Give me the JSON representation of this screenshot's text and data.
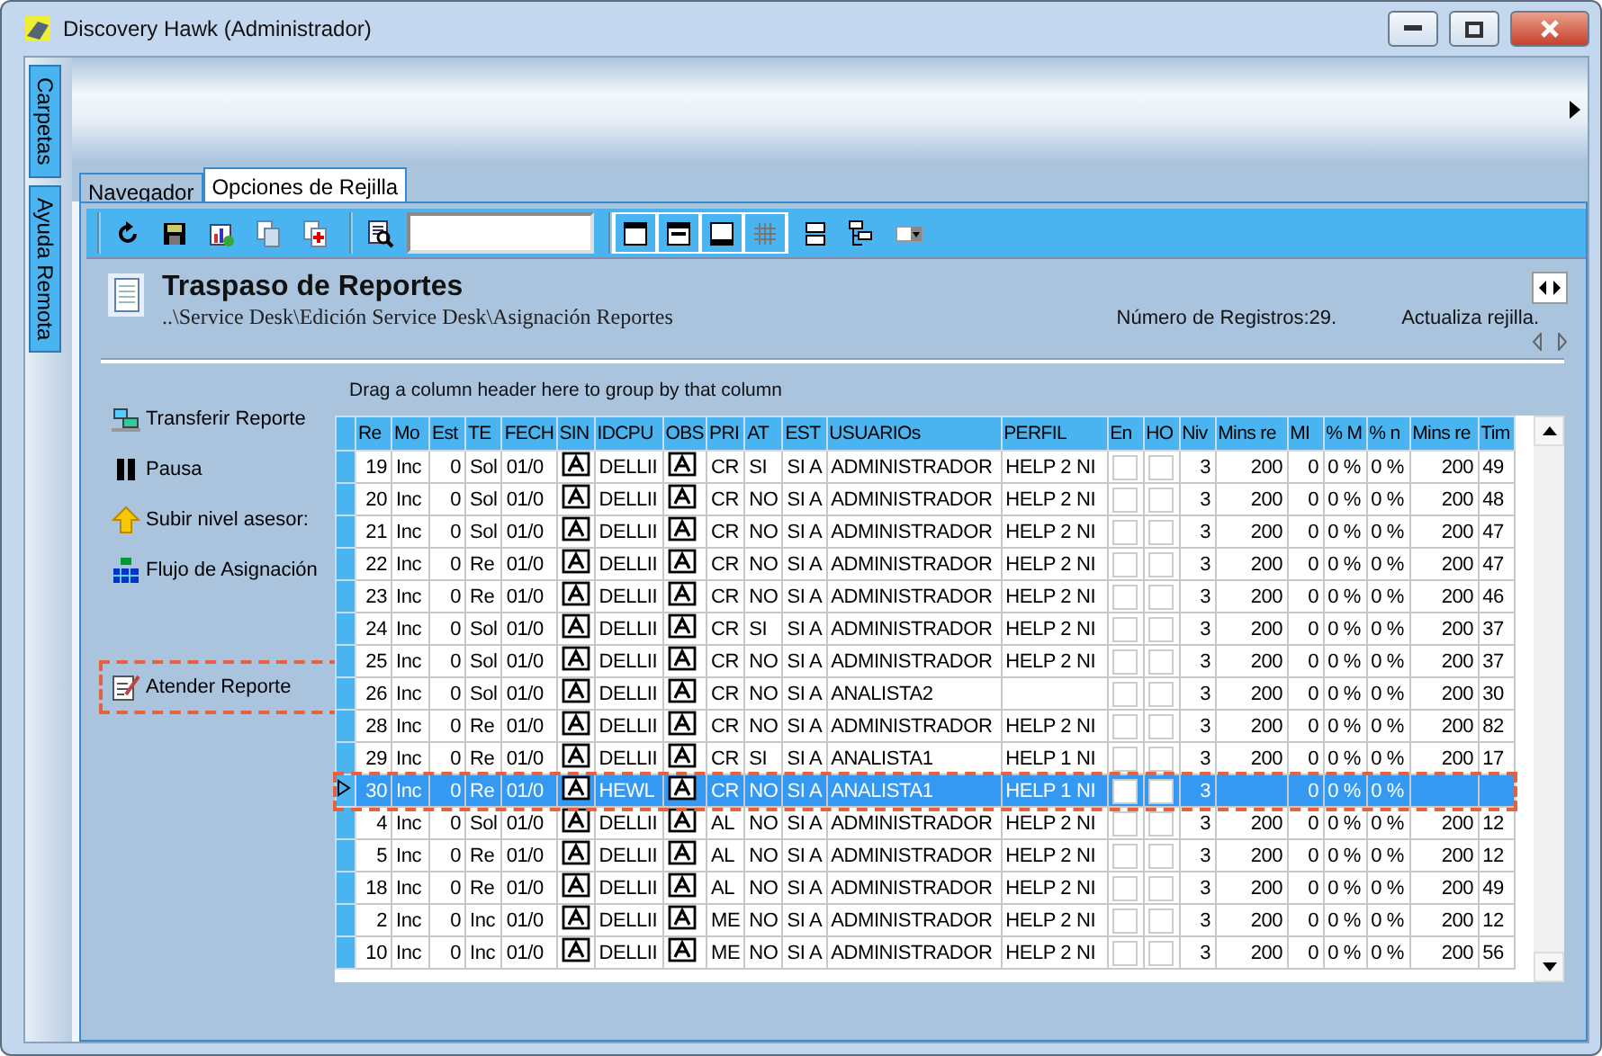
{
  "window": {
    "title": "Discovery Hawk (Administrador)"
  },
  "side_tabs": [
    {
      "label": "Carpetas"
    },
    {
      "label": "Ayuda Remota"
    }
  ],
  "tabs": [
    {
      "label": "Navegador",
      "selected": false
    },
    {
      "label": "Opciones de Rejilla",
      "selected": true
    }
  ],
  "page": {
    "title": "Traspaso de Reportes",
    "path": "..\\Service Desk\\Edición Service Desk\\Asignación Reportes",
    "record_count": "Número de Registros:29.",
    "refresh_label": "Actualiza rejilla."
  },
  "actions": [
    {
      "label": "Transferir Reporte",
      "kind": "transfer",
      "highlighted": false
    },
    {
      "label": "Pausa",
      "kind": "pause",
      "highlighted": false
    },
    {
      "label": "Subir nivel asesor:",
      "kind": "raise",
      "highlighted": false
    },
    {
      "label": "Flujo de Asignación",
      "kind": "flow",
      "highlighted": false
    },
    {
      "label": "Atender Reporte",
      "kind": "attend",
      "highlighted": true
    }
  ],
  "grid": {
    "group_hint": "Drag a column header here to group by that column",
    "columns": [
      {
        "label": "Re",
        "kind": "num"
      },
      {
        "label": "Mo",
        "kind": "text"
      },
      {
        "label": "Est",
        "kind": "num"
      },
      {
        "label": "TE",
        "kind": "text"
      },
      {
        "label": "FECH",
        "kind": "text"
      },
      {
        "label": "SIN",
        "kind": "icon"
      },
      {
        "label": "IDCPU",
        "kind": "text"
      },
      {
        "label": "OBS",
        "kind": "icon"
      },
      {
        "label": "PRI",
        "kind": "text"
      },
      {
        "label": "AT",
        "kind": "text"
      },
      {
        "label": "EST",
        "kind": "text"
      },
      {
        "label": "USUARIOs",
        "kind": "text"
      },
      {
        "label": "PERFIL",
        "kind": "text"
      },
      {
        "label": "En",
        "kind": "check"
      },
      {
        "label": "HO",
        "kind": "check"
      },
      {
        "label": "Niv",
        "kind": "num"
      },
      {
        "label": "Mins re",
        "kind": "num"
      },
      {
        "label": "MI",
        "kind": "num"
      },
      {
        "label": "% M",
        "kind": "text"
      },
      {
        "label": "% n",
        "kind": "text"
      },
      {
        "label": "Mins re",
        "kind": "num"
      },
      {
        "label": "Tim",
        "kind": "text"
      }
    ],
    "rows": [
      {
        "selected": false,
        "highlighted": false,
        "cells": [
          "19",
          "Inc",
          "0",
          "Sol",
          "01/0",
          "",
          "DELLII",
          "",
          "CR",
          "SI",
          "SI A",
          "ADMINISTRADOR",
          "HELP 2 NI",
          "",
          "",
          "3",
          "200",
          "0",
          "0 %",
          "0 %",
          "200",
          "49"
        ],
        "checks": [
          false,
          false
        ]
      },
      {
        "selected": false,
        "highlighted": false,
        "cells": [
          "20",
          "Inc",
          "0",
          "Sol",
          "01/0",
          "",
          "DELLII",
          "",
          "CR",
          "NO",
          "SI A",
          "ADMINISTRADOR",
          "HELP 2 NI",
          "",
          "",
          "3",
          "200",
          "0",
          "0 %",
          "0 %",
          "200",
          "48"
        ],
        "checks": [
          false,
          false
        ]
      },
      {
        "selected": false,
        "highlighted": false,
        "cells": [
          "21",
          "Inc",
          "0",
          "Sol",
          "01/0",
          "",
          "DELLII",
          "",
          "CR",
          "NO",
          "SI A",
          "ADMINISTRADOR",
          "HELP 2 NI",
          "",
          "",
          "3",
          "200",
          "0",
          "0 %",
          "0 %",
          "200",
          "47"
        ],
        "checks": [
          false,
          false
        ]
      },
      {
        "selected": false,
        "highlighted": false,
        "cells": [
          "22",
          "Inc",
          "0",
          "Re",
          "01/0",
          "",
          "DELLII",
          "",
          "CR",
          "NO",
          "SI A",
          "ADMINISTRADOR",
          "HELP 2 NI",
          "",
          "",
          "3",
          "200",
          "0",
          "0 %",
          "0 %",
          "200",
          "47"
        ],
        "checks": [
          false,
          false
        ]
      },
      {
        "selected": false,
        "highlighted": false,
        "cells": [
          "23",
          "Inc",
          "0",
          "Re",
          "01/0",
          "",
          "DELLII",
          "",
          "CR",
          "NO",
          "SI A",
          "ADMINISTRADOR",
          "HELP 2 NI",
          "",
          "",
          "3",
          "200",
          "0",
          "0 %",
          "0 %",
          "200",
          "46"
        ],
        "checks": [
          false,
          false
        ]
      },
      {
        "selected": false,
        "highlighted": false,
        "cells": [
          "24",
          "Inc",
          "0",
          "Sol",
          "01/0",
          "",
          "DELLII",
          "",
          "CR",
          "SI",
          "SI A",
          "ADMINISTRADOR",
          "HELP 2 NI",
          "",
          "",
          "3",
          "200",
          "0",
          "0 %",
          "0 %",
          "200",
          "37"
        ],
        "checks": [
          false,
          false
        ]
      },
      {
        "selected": false,
        "highlighted": false,
        "cells": [
          "25",
          "Inc",
          "0",
          "Sol",
          "01/0",
          "",
          "DELLII",
          "",
          "CR",
          "NO",
          "SI A",
          "ADMINISTRADOR",
          "HELP 2 NI",
          "",
          "",
          "3",
          "200",
          "0",
          "0 %",
          "0 %",
          "200",
          "37"
        ],
        "checks": [
          false,
          false
        ]
      },
      {
        "selected": false,
        "highlighted": false,
        "cells": [
          "26",
          "Inc",
          "0",
          "Sol",
          "01/0",
          "",
          "DELLII",
          "",
          "CR",
          "NO",
          "SI A",
          "ANALISTA2",
          "",
          "",
          "",
          "3",
          "200",
          "0",
          "0 %",
          "0 %",
          "200",
          "30"
        ],
        "checks": [
          false,
          false
        ]
      },
      {
        "selected": false,
        "highlighted": false,
        "cells": [
          "28",
          "Inc",
          "0",
          "Re",
          "01/0",
          "",
          "DELLII",
          "",
          "CR",
          "NO",
          "SI A",
          "ADMINISTRADOR",
          "HELP 2 NI",
          "",
          "",
          "3",
          "200",
          "0",
          "0 %",
          "0 %",
          "200",
          "82"
        ],
        "checks": [
          false,
          false
        ]
      },
      {
        "selected": false,
        "highlighted": false,
        "cells": [
          "29",
          "Inc",
          "0",
          "Re",
          "01/0",
          "",
          "DELLII",
          "",
          "CR",
          "SI",
          "SI A",
          "ANALISTA1",
          "HELP 1 NI",
          "",
          "",
          "3",
          "200",
          "0",
          "0 %",
          "0 %",
          "200",
          "17"
        ],
        "checks": [
          false,
          false
        ]
      },
      {
        "selected": true,
        "highlighted": true,
        "cells": [
          "30",
          "Inc",
          "0",
          "Re",
          "01/0",
          "",
          "HEWL",
          "",
          "CR",
          "NO",
          "SI A",
          "ANALISTA1",
          "HELP 1 NI",
          "",
          "",
          "3",
          "",
          "0",
          "0 %",
          "0 %",
          "",
          ""
        ],
        "checks": [
          false,
          false
        ]
      },
      {
        "selected": false,
        "highlighted": false,
        "cells": [
          "4",
          "Inc",
          "0",
          "Sol",
          "01/0",
          "",
          "DELLII",
          "",
          "AL",
          "NO",
          "SI A",
          "ADMINISTRADOR",
          "HELP 2 NI",
          "",
          "",
          "3",
          "200",
          "0",
          "0 %",
          "0 %",
          "200",
          "12"
        ],
        "checks": [
          false,
          false
        ]
      },
      {
        "selected": false,
        "highlighted": false,
        "cells": [
          "5",
          "Inc",
          "0",
          "Re",
          "01/0",
          "",
          "DELLII",
          "",
          "AL",
          "NO",
          "SI A",
          "ADMINISTRADOR",
          "HELP 2 NI",
          "",
          "",
          "3",
          "200",
          "0",
          "0 %",
          "0 %",
          "200",
          "12"
        ],
        "checks": [
          false,
          false
        ]
      },
      {
        "selected": false,
        "highlighted": false,
        "cells": [
          "18",
          "Inc",
          "0",
          "Re",
          "01/0",
          "",
          "DELLII",
          "",
          "AL",
          "NO",
          "SI A",
          "ADMINISTRADOR",
          "HELP 2 NI",
          "",
          "",
          "3",
          "200",
          "0",
          "0 %",
          "0 %",
          "200",
          "49"
        ],
        "checks": [
          false,
          false
        ]
      },
      {
        "selected": false,
        "highlighted": false,
        "cells": [
          "2",
          "Inc",
          "0",
          "Inc",
          "01/0",
          "",
          "DELLII",
          "",
          "ME",
          "NO",
          "SI A",
          "ADMINISTRADOR",
          "HELP 2 NI",
          "",
          "",
          "3",
          "200",
          "0",
          "0 %",
          "0 %",
          "200",
          "12"
        ],
        "checks": [
          false,
          false
        ]
      },
      {
        "selected": false,
        "highlighted": false,
        "cells": [
          "10",
          "Inc",
          "0",
          "Inc",
          "01/0",
          "",
          "DELLII",
          "",
          "ME",
          "NO",
          "SI A",
          "ADMINISTRADOR",
          "HELP 2 NI",
          "",
          "",
          "3",
          "200",
          "0",
          "0 %",
          "0 %",
          "200",
          "56"
        ],
        "checks": [
          false,
          false
        ]
      }
    ]
  }
}
